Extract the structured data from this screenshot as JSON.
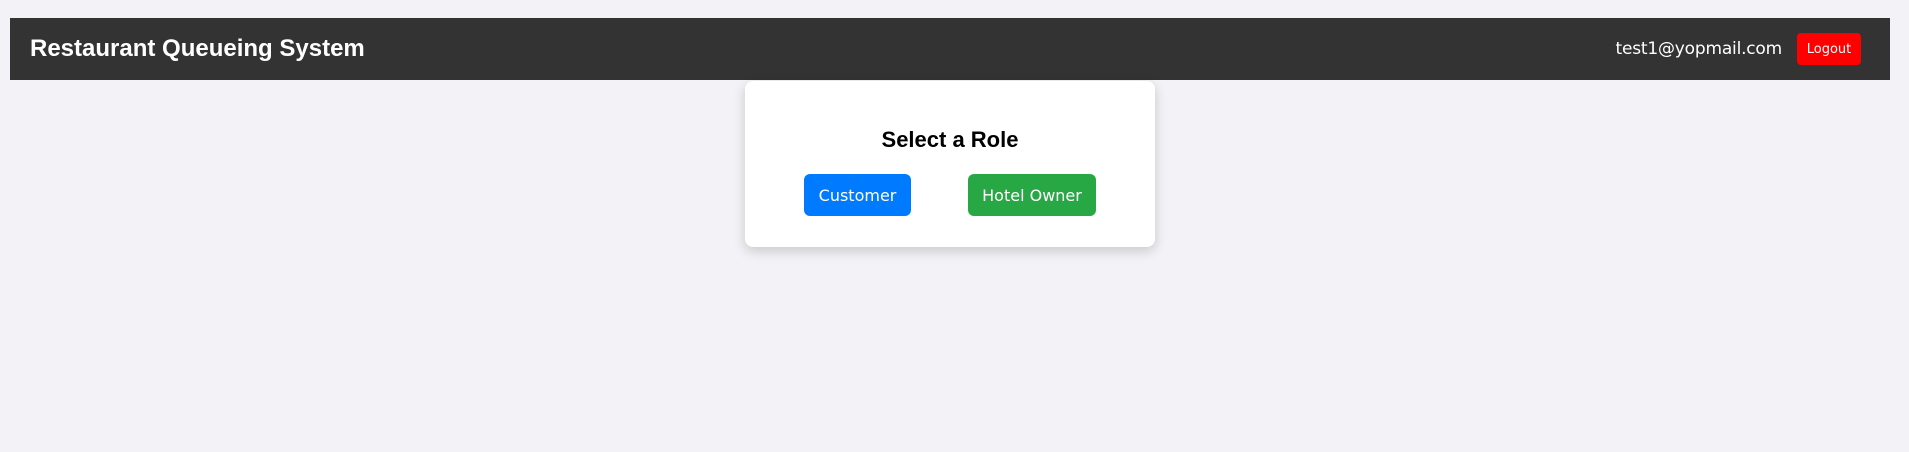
{
  "header": {
    "title": "Restaurant Queueing System",
    "user_email": "test1@yopmail.com",
    "logout_label": "Logout"
  },
  "role_card": {
    "title": "Select a Role",
    "customer_label": "Customer",
    "owner_label": "Hotel Owner"
  },
  "colors": {
    "navbar": "#333333",
    "logout": "#ff0000",
    "customer": "#007bff",
    "owner": "#28a745",
    "background": "#f3f3f7"
  }
}
